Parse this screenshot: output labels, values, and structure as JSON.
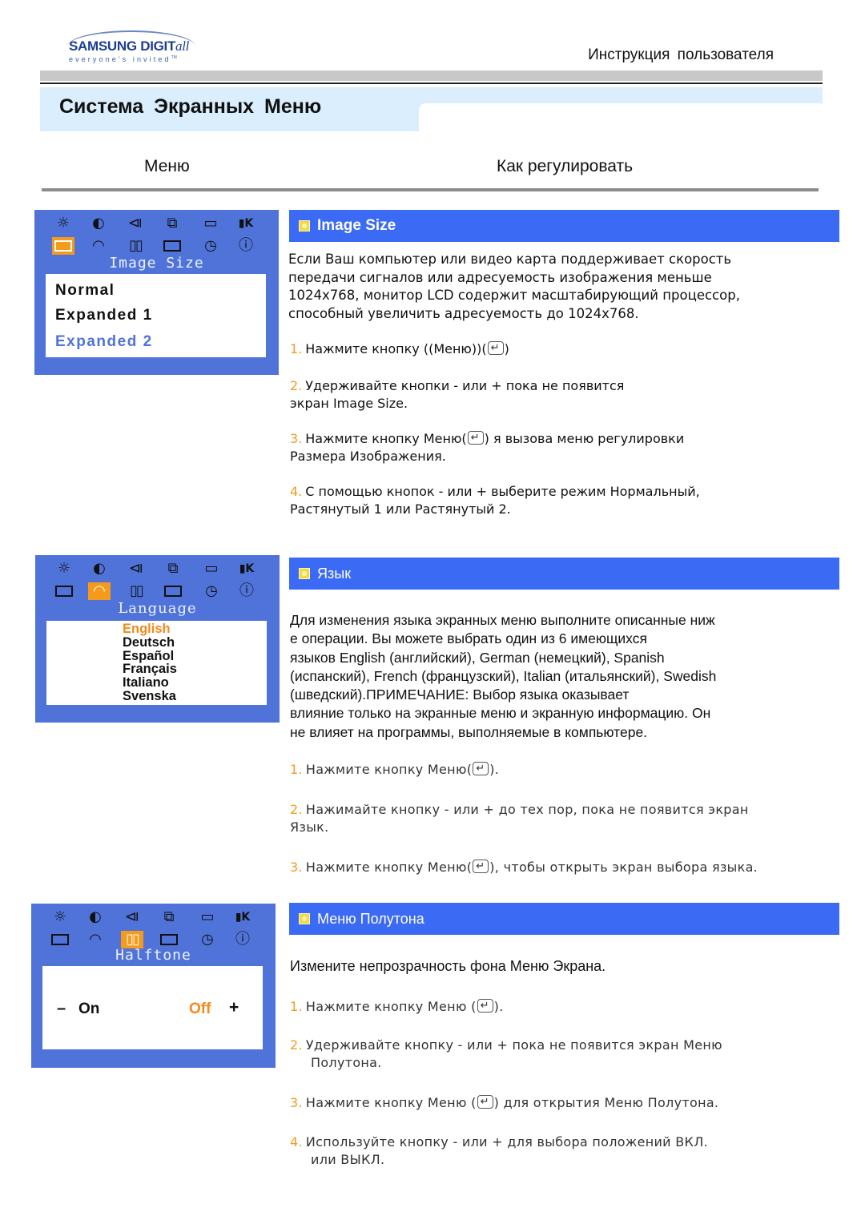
{
  "header": {
    "logo_brand": "SAMSUNG DIGIT",
    "logo_brand_suffix": "all",
    "logo_tagline": "everyone's invited",
    "logo_tm": "TM",
    "manual_title": "Инструкция пользователя",
    "page_title": "Система Экранных Меню",
    "column_menu": "Меню",
    "column_how": "Как регулировать"
  },
  "osd_icons": [
    "brightness-icon",
    "contrast-icon",
    "position-icon",
    "window-icon",
    "video-icon",
    "color-temperature-icon",
    "image-size-icon",
    "language-icon",
    "halftone-icon",
    "pip-icon",
    "timer-icon",
    "info-icon"
  ],
  "sections": [
    {
      "id": "image-size",
      "title": "Image Size",
      "osd": {
        "title": "Image Size",
        "selected_icon": "image-size-icon",
        "options": [
          "Normal",
          "Expanded 1",
          "Expanded 2"
        ],
        "highlighted_option": "Expanded 2",
        "highlight_color": "#4f73d8"
      },
      "intro": "Если Ваш компьютер или видео карта поддерживает скорость\n передачи сигналов или адресуемость изображения меньше\n1024x768, монитор LCD содержит масштабирующий процессор,\n способный увеличить адресуемость до 1024x768.",
      "steps": [
        {
          "num": "1.",
          "before": "Нажмите кнопку ((Меню))(",
          "after": ")",
          "key": true
        },
        {
          "num": "2.",
          "before": "Удерживайте кнопки -  или + пока не появится",
          "cont": "экран Image Size."
        },
        {
          "num": "3.",
          "before": "Нажмите кнопку Меню(",
          "after": ") я вызова меню регулировки",
          "cont": "Размера Изображения.",
          "key": true
        },
        {
          "num": "4.",
          "before": "С помощью кнопок -  или + выберите режим Нормальный,",
          "cont": "Растянутый 1 или Растянутый 2."
        }
      ]
    },
    {
      "id": "language",
      "title": "Язык",
      "osd": {
        "title": "Language",
        "selected_icon": "language-icon",
        "options": [
          "English",
          "Deutsch",
          "Español",
          "Français",
          "Italiano",
          "Svenska"
        ],
        "highlighted_option": "English",
        "highlight_color": "#f5891b"
      },
      "intro": "Для изменения языка экранных меню выполните описанные ниж\nе операции. Вы можете выбрать один из 6 имеющихся\nязыков English (английский), German (немецкий), Spanish\n(испанский), French (французский), Italian (итальянский), Swedish\n(шведский).ПРИМЕЧАНИЕ: Выбор языка оказывает\nвлияние только на экранные меню и экранную информацию. Он\nне влияет на программы, выполняемые в компьютере.",
      "steps": [
        {
          "num": "1.",
          "before": "Нажмите кнопку Меню(",
          "after": ").",
          "key": true
        },
        {
          "num": "2.",
          "before": "Нажимайте кнопку - или + до тех пор, пока не появится экран",
          "cont": "Язык."
        },
        {
          "num": "3.",
          "before": "Нажмите кнопку Меню(",
          "after": "), чтобы открыть экран выбора языка.",
          "key": true
        }
      ]
    },
    {
      "id": "halftone",
      "title": "Меню Полутона",
      "osd": {
        "title": "Halftone",
        "selected_icon": "halftone-icon",
        "minus": "–",
        "on_label": "On",
        "off_label": "Off",
        "plus": "+",
        "selected_value": "Off",
        "highlight_color": "#f5891b"
      },
      "intro": "Измените непрозрачность фона Меню Экрана.",
      "steps": [
        {
          "num": "1.",
          "before": "Нажмите кнопку Меню (",
          "after": ").",
          "key": true
        },
        {
          "num": "2.",
          "before": "Удерживайте кнопку - или + пока не появится экран Меню",
          "cont": "Полутона."
        },
        {
          "num": "3.",
          "before": "Нажмите кнопку Меню (",
          "after": ") для открытия Меню Полутона.",
          "key": true
        },
        {
          "num": "4.",
          "before": "Используйте кнопку - или + для выбора положений ВКЛ.",
          "cont": "или ВЫКЛ."
        }
      ]
    }
  ],
  "colors": {
    "section_bar": "#3b6af5",
    "osd_background": "#4f73d8",
    "osd_selected": "#f59a1b",
    "step_number": "#f39a1e",
    "title_band": "#dbeefd"
  }
}
